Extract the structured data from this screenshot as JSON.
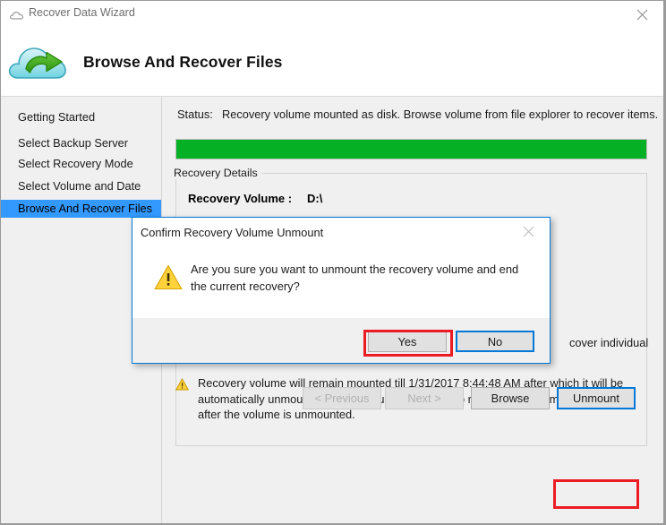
{
  "window": {
    "title": "Recover Data Wizard",
    "title_icon": "cloud-icon",
    "close_icon": "close-icon"
  },
  "header": {
    "logo_icon": "cloud-restore-icon",
    "title": "Browse And Recover Files"
  },
  "sidebar": {
    "items": [
      {
        "label": "Getting Started",
        "selected": false
      },
      {
        "label": "Select Backup Server",
        "selected": false
      },
      {
        "label": "Select Recovery Mode",
        "selected": false
      },
      {
        "label": "Select Volume and Date",
        "selected": false
      },
      {
        "label": "Browse And Recover Files",
        "selected": true
      }
    ]
  },
  "main": {
    "status_label": "Status:",
    "status_value": "Recovery volume mounted as disk. Browse volume from file explorer to recover items.",
    "progress": {
      "percent": 100,
      "color": "#06b025"
    },
    "details_group_title": "Recovery Details",
    "recovery_volume_label": "Recovery Volume :",
    "recovery_volume_value": "D:\\",
    "obscured_text_tail": "cover individual",
    "notice_icon": "warning-triangle-icon",
    "notice_text": "Recovery volume will remain mounted till 1/31/2017 8:44:48 AM after which it will be automatically unmounted. Any backups scheduled to run during this time will run only after the volume is unmounted."
  },
  "footer_buttons": {
    "previous": {
      "label": "< Previous",
      "disabled": true
    },
    "next": {
      "label": "Next >",
      "disabled": true
    },
    "browse": {
      "label": "Browse",
      "disabled": false
    },
    "unmount": {
      "label": "Unmount",
      "disabled": false,
      "focused": true,
      "highlight": "#ec1c24"
    }
  },
  "dialog": {
    "title": "Confirm Recovery Volume Unmount",
    "close_icon": "close-icon",
    "warn_icon": "warning-triangle-icon",
    "message": "Are you sure you want to unmount the recovery volume and end the current recovery?",
    "yes_label": "Yes",
    "no_label": "No",
    "yes_highlight": "#ec1c24",
    "no_focus_color": "#0078d7",
    "border_color": "#0078d7"
  }
}
